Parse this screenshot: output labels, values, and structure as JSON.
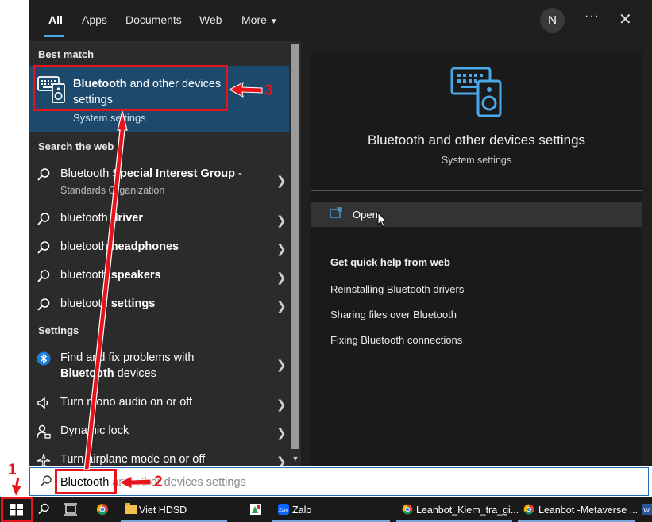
{
  "nav": {
    "tabs": [
      {
        "label": "All",
        "active": true
      },
      {
        "label": "Apps"
      },
      {
        "label": "Documents"
      },
      {
        "label": "Web"
      },
      {
        "label": "More"
      }
    ],
    "avatar_initial": "N",
    "more_dots": "···",
    "close": "✕"
  },
  "sections": {
    "best_match": "Best match",
    "search_web": "Search the web",
    "settings": "Settings"
  },
  "best_match": {
    "title_bold": "Bluetooth",
    "title_rest": " and other devices settings",
    "subtitle": "System settings",
    "icon": "devices-speaker-icon"
  },
  "web_results": [
    {
      "bold_prefix": "",
      "text": "Bluetooth ",
      "bold": "Special Interest Group",
      "suffix": " -",
      "sub": "Standards Organization"
    },
    {
      "text": "bluetooth ",
      "bold": "driver"
    },
    {
      "text": "bluetooth ",
      "bold": "headphones"
    },
    {
      "text": "bluetooth ",
      "bold": "speakers"
    },
    {
      "text": "bluetooth ",
      "bold": "settings"
    }
  ],
  "settings_results": [
    {
      "line1": "Find and fix problems with",
      "line2_bold": "Bluetooth",
      "line2_rest": " devices",
      "icon": "bluetooth-icon"
    },
    {
      "text": "Turn mono audio on or off",
      "icon": "audio-icon"
    },
    {
      "text": "Dynamic lock",
      "icon": "person-lock-icon"
    },
    {
      "text": "Turn airplane mode on or off",
      "icon": "airplane-icon"
    }
  ],
  "preview": {
    "title": "Bluetooth and other devices settings",
    "subtitle": "System settings",
    "open_label": "Open",
    "help_title": "Get quick help from web",
    "help_links": [
      "Reinstalling Bluetooth drivers",
      "Sharing files over Bluetooth",
      "Fixing Bluetooth connections"
    ]
  },
  "search": {
    "typed": "Bluetooth",
    "ghost": "Bluetooth and other devices settings"
  },
  "taskbar": {
    "items": [
      {
        "label": "Viet HDSD"
      },
      {
        "label": "Zalo"
      },
      {
        "label": "Leanbot_Kiem_tra_gi..."
      },
      {
        "label": "Leanbot -Metaverse ..."
      }
    ]
  },
  "annotations": {
    "step1": "1",
    "step2": "2",
    "step3": "3"
  },
  "colors": {
    "accent": "#4aa8e8",
    "highlight": "#1d4a6c",
    "annotation": "#e8141b"
  }
}
